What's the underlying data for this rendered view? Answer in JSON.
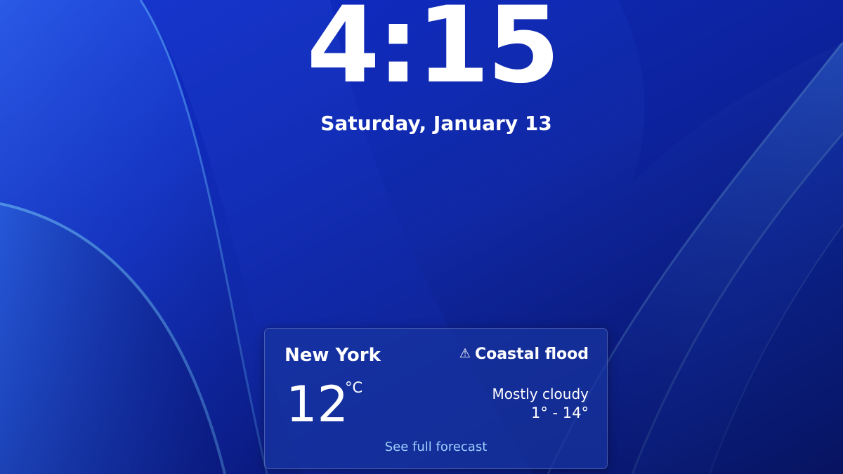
{
  "lockscreen": {
    "time": "4:15",
    "date": "Saturday, January 13"
  },
  "weather": {
    "city": "New York",
    "alert_icon": "warning-icon",
    "alert_glyph": "⚠",
    "alert_text": "Coastal flood",
    "temperature": "12",
    "unit": "°C",
    "condition": "Mostly cloudy",
    "range": "1° - 14°",
    "forecast_link": "See full forecast"
  },
  "colors": {
    "background": "#1231c4",
    "card": "#1834a0",
    "link": "#9fd0ff",
    "text": "#ffffff"
  }
}
